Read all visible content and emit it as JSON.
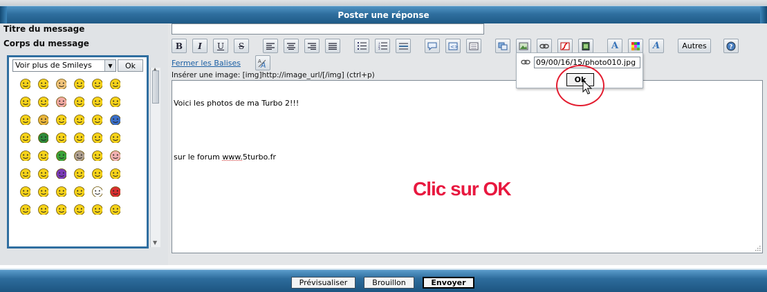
{
  "header": {
    "title": "Poster une réponse"
  },
  "labels": {
    "title": "Titre du message",
    "body": "Corps du message"
  },
  "title_input": {
    "value": ""
  },
  "toolbar": {
    "autres_label": "Autres"
  },
  "tag_bar": {
    "close_tags_link": "Fermer les Balises"
  },
  "insert_hint": "Insérer une image: [img]http://image_url/[/img] (ctrl+p)",
  "message": {
    "line1": "Voici les photos de ma Turbo 2!!!",
    "line2_prefix": "sur le forum ",
    "line2_link": "www.",
    "line2_suffix": "5turbo.fr"
  },
  "annotation": "Clic sur OK",
  "popup": {
    "url_value": "09/00/16/15/photo010.jpg",
    "ok_label": "Ok"
  },
  "smiley_panel": {
    "select_value": "Voir plus de Smileys",
    "ok_label": "Ok"
  },
  "buttons": {
    "preview": "Prévisualiser",
    "draft": "Brouillon",
    "send": "Envoyer"
  },
  "colors": {
    "accent": "#2f6f9f",
    "annotation": "#e8183f",
    "circle": "#e31d30"
  }
}
